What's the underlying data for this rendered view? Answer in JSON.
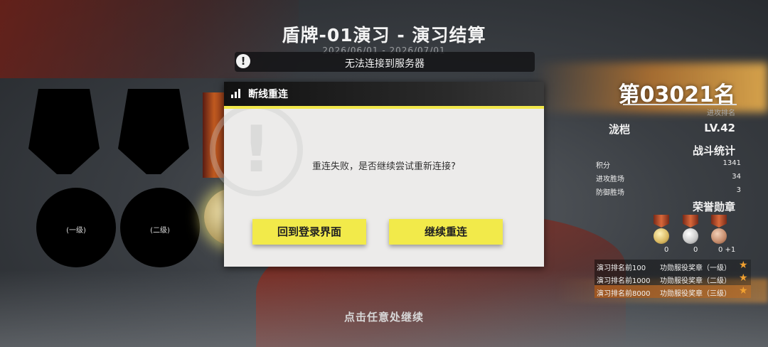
{
  "header": {
    "title": "盾牌-01演习 - 演习结算",
    "date_range": "2026/06/01 - 2026/07/01"
  },
  "alert": {
    "icon": "exclamation-icon",
    "text": "无法连接到服务器"
  },
  "medals_left": [
    {
      "label": "(一级)"
    },
    {
      "label": "(二级)"
    }
  ],
  "dialog": {
    "title": "断线重连",
    "icon": "signal-icon",
    "message": "重连失败，是否继续尝试重新连接?",
    "buttons": {
      "back_login": "回到登录界面",
      "retry": "继续重连"
    }
  },
  "footer": {
    "continue_hint": "点击任意处继续"
  },
  "player": {
    "rank": "第03021名",
    "rank_sub": "进攻排名",
    "name": "泷桤",
    "level": "LV.42"
  },
  "battle_stats": {
    "title": "战斗统计",
    "rows": [
      {
        "label": "积分",
        "value": "1341"
      },
      {
        "label": "进攻胜场",
        "value": "34"
      },
      {
        "label": "防御胜场",
        "value": "3"
      }
    ]
  },
  "honor_medals": {
    "title": "荣誉勋章",
    "badges": [
      {
        "icon": "gold-medal-icon",
        "count": "0",
        "color": "#d9b860"
      },
      {
        "icon": "silver-medal-icon",
        "count": "0",
        "color": "#c8c8c8"
      },
      {
        "icon": "bronze-medal-icon",
        "count": "0 +1",
        "color": "#c48a6a"
      }
    ],
    "awards": [
      {
        "condition": "演习排名前100",
        "name": "功勋服役奖章（一级）"
      },
      {
        "condition": "演习排名前1000",
        "name": "功勋服役奖章（二级）"
      },
      {
        "condition": "演习排名前8000",
        "name": "功勋服役奖章（三级）"
      }
    ]
  },
  "colors": {
    "accent_yellow": "#f2ea4a",
    "star_orange": "#f0a030"
  }
}
